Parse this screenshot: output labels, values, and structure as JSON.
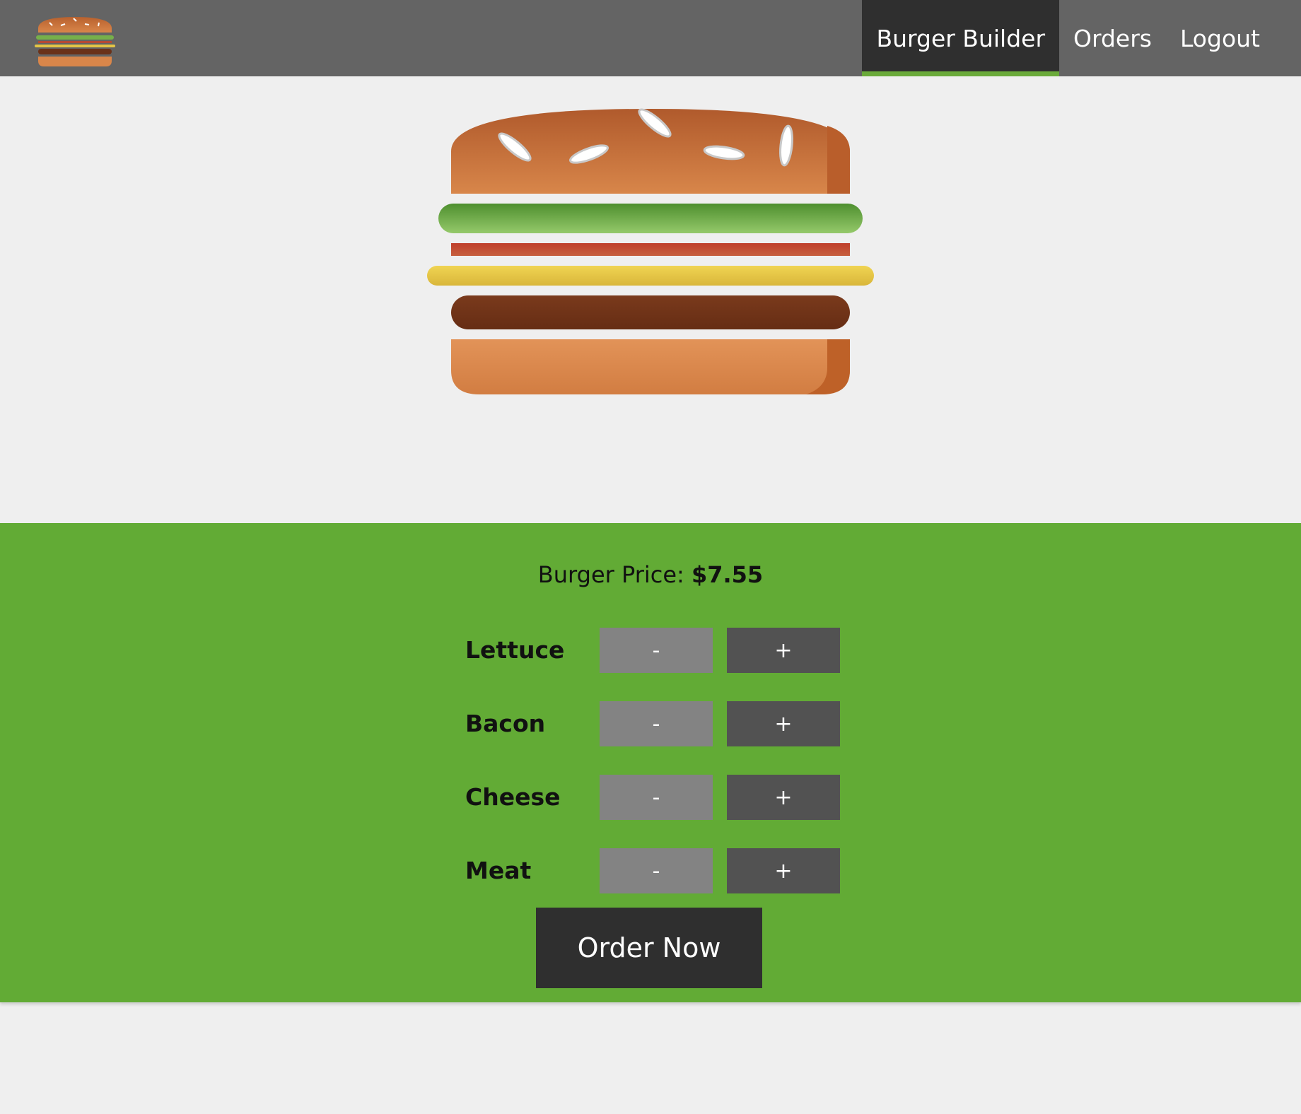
{
  "nav": {
    "items": [
      {
        "label": "Burger Builder",
        "active": true
      },
      {
        "label": "Orders",
        "active": false
      },
      {
        "label": "Logout",
        "active": false
      }
    ]
  },
  "logo": {
    "icon": "burger-logo-icon"
  },
  "burger": {
    "layers": [
      "bread-top",
      "lettuce",
      "bacon",
      "cheese",
      "meat",
      "bread-bottom"
    ]
  },
  "controls": {
    "price_label": "Burger Price:",
    "price_value": "$7.55",
    "ingredients": [
      {
        "label": "Lettuce",
        "less": "-",
        "more": "+"
      },
      {
        "label": "Bacon",
        "less": "-",
        "more": "+"
      },
      {
        "label": "Cheese",
        "less": "-",
        "more": "+"
      },
      {
        "label": "Meat",
        "less": "-",
        "more": "+"
      }
    ],
    "order_label": "Order Now"
  },
  "colors": {
    "toolbar": "#646464",
    "nav_active_bg": "#2f2f2f",
    "nav_active_accent": "#6aaa3a",
    "controls_bg": "#62ab35",
    "less_button": "#838383",
    "more_button": "#525252",
    "order_button": "#2f2f2f"
  }
}
